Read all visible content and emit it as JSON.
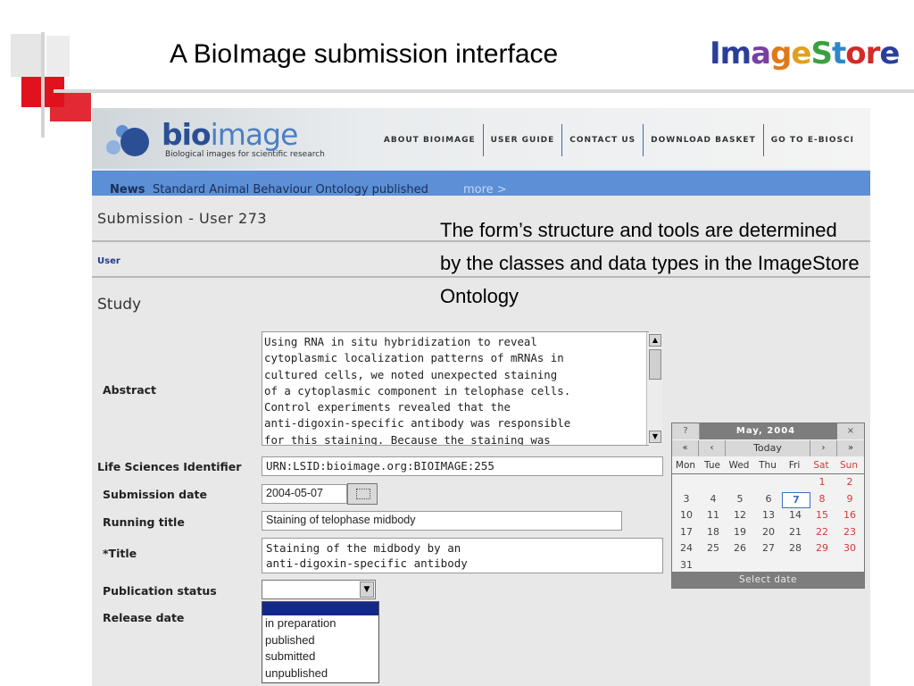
{
  "slide": {
    "title": "A BioImage submission interface",
    "logo": {
      "letters": [
        "I",
        "m",
        "a",
        "g",
        "e",
        "S",
        "t",
        "o",
        "r",
        "e"
      ],
      "colors": [
        "#2b3f9a",
        "#2b3f9a",
        "#7a3fa0",
        "#e07a18",
        "#e0a020",
        "#3aa040",
        "#2c88c8",
        "#d42a2a",
        "#d42a2a",
        "#2b3f9a"
      ]
    },
    "callout": "The form’s structure and tools are determined by the classes and data types in the ImageStore Ontology"
  },
  "bioimage": {
    "logo_main": "bio",
    "logo_light": "image",
    "tagline": "Biological images for scientific research",
    "nav": [
      "ABOUT BIOIMAGE",
      "USER GUIDE",
      "CONTACT US",
      "DOWNLOAD BASKET",
      "GO TO E-BIOSCI"
    ],
    "news_label": "News",
    "news_text": "Standard Animal Behaviour Ontology published",
    "news_more": "more >",
    "submission_title": "Submission - User 273",
    "user_link": "User",
    "section": "Study"
  },
  "form": {
    "abstract_label": "Abstract",
    "abstract_value": "Using RNA in situ hybridization to reveal\ncytoplasmic localization patterns of mRNAs in\ncultured cells, we noted unexpected staining\nof a cytoplasmic component in telophase cells.\nControl experiments revealed that the\nanti-digoxin-specific antibody was responsible\nfor this staining. Because the staining was",
    "lsid_label": "Life Sciences Identifier",
    "lsid_value": "URN:LSID:bioimage.org:BIOIMAGE:255",
    "submission_date_label": "Submission date",
    "submission_date_value": "2004-05-07",
    "running_title_label": "Running title",
    "running_title_value": "Staining of telophase midbody",
    "title_label": "*Title",
    "title_value": "Staining of the midbody by an\nanti-digoxin-specific antibody",
    "publication_status_label": "Publication status",
    "publication_status_options": [
      "in preparation",
      "published",
      "submitted",
      "unpublished"
    ],
    "release_date_label": "Release date"
  },
  "calendar": {
    "help": "?",
    "month": "May, 2004",
    "close": "×",
    "nav_prev_year": "«",
    "nav_prev_month": "‹",
    "today": "Today",
    "nav_next_month": "›",
    "nav_next_year": "»",
    "days": [
      "Mon",
      "Tue",
      "Wed",
      "Thu",
      "Fri",
      "Sat",
      "Sun"
    ],
    "weeks": [
      [
        "",
        "",
        "",
        "",
        "",
        "1",
        "2"
      ],
      [
        "3",
        "4",
        "5",
        "6",
        "7",
        "8",
        "9"
      ],
      [
        "10",
        "11",
        "12",
        "13",
        "14",
        "15",
        "16"
      ],
      [
        "17",
        "18",
        "19",
        "20",
        "21",
        "22",
        "23"
      ],
      [
        "24",
        "25",
        "26",
        "27",
        "28",
        "29",
        "30"
      ],
      [
        "31",
        "",
        "",
        "",
        "",
        "",
        ""
      ]
    ],
    "selected_day": "7",
    "footer": "Select date"
  }
}
